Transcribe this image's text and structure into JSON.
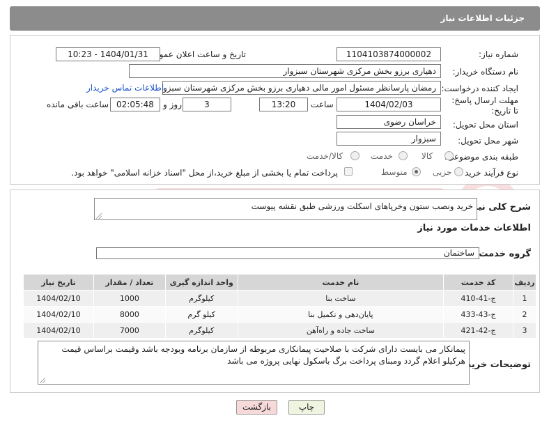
{
  "header": {
    "title": "جزئیات اطلاعات نیاز"
  },
  "fields": {
    "need_number_label": "شماره نیاز:",
    "need_number": "1104103874000002",
    "announce_label": "تاریخ و ساعت اعلان عمومی:",
    "announce_value": "1404/01/31 - 10:23",
    "buyer_org_label": "نام دستگاه خریدار:",
    "buyer_org": "دهیاری برزو بخش مرکزی شهرستان سبزوار",
    "requester_label": "ایجاد کننده درخواست:",
    "requester": "رمضان پارسانظر مسئول امور مالی دهیاری برزو بخش مرکزی شهرستان سبزوار",
    "contact_link": "اطلاعات تماس خریدار",
    "deadline_label": "مهلت ارسال پاسخ: تا تاریخ:",
    "deadline_date": "1404/02/03",
    "time_label": "ساعت",
    "deadline_time": "13:20",
    "days_value": "3",
    "days_label": "روز و",
    "remaining_time": "02:05:48",
    "remaining_label": "ساعت باقی مانده",
    "province_label": "استان محل تحویل:",
    "province": "خراسان رضوی",
    "city_label": "شهر محل تحویل:",
    "city": "سبزوار",
    "category_label": "طبقه بندی موضوعی:",
    "category_options": [
      "کالا",
      "خدمت",
      "کالا/خدمت"
    ],
    "purchase_type_label": "نوع فرآیند خرید :",
    "purchase_options": [
      "جزیی",
      "متوسط"
    ],
    "payment_note": "پرداخت تمام یا بخشی از مبلغ خرید،از محل \"اسناد خزانه اسلامی\" خواهد بود."
  },
  "summary": {
    "label": "شرح کلی نیاز:",
    "text": "خرید ونصب ستون وخرپاهای اسکلت ورزشی طبق نقشه پیوست"
  },
  "services": {
    "section_title": "اطلاعات خدمات مورد نیاز",
    "group_label": "گروه خدمت:",
    "group_value": "ساختمان",
    "columns": [
      "ردیف",
      "کد خدمت",
      "نام خدمت",
      "واحد اندازه گیری",
      "تعداد / مقدار",
      "تاریخ نیاز"
    ],
    "rows": [
      {
        "row": "1",
        "code": "ج-41-410",
        "name": "ساخت بنا",
        "unit": "کیلوگرم",
        "qty": "1000",
        "date": "1404/02/10"
      },
      {
        "row": "2",
        "code": "ج-43-433",
        "name": "پایان‌دهی و تکمیل بنا",
        "unit": "کیلو گرم",
        "qty": "8000",
        "date": "1404/02/10"
      },
      {
        "row": "3",
        "code": "ج-42-421",
        "name": "ساخت جاده و راه‌آهن",
        "unit": "کیلوگرم",
        "qty": "7000",
        "date": "1404/02/10"
      }
    ]
  },
  "buyer_notes": {
    "label": "توضیحات خریدار:",
    "text": "پیمانکار می بایست دارای شرکت با صلاحیت پیمانکاری مربوطه از سازمان برنامه وبودجه باشد وقیمت براساس قیمت هرکیلو اعلام گردد ومبنای پرداخت برگ باسکول نهایی پروژه می باشد"
  },
  "buttons": {
    "print": "چاپ",
    "back": "بازگشت"
  },
  "colors": {
    "header_bg": "#8c8c8c",
    "link": "#1a54c7",
    "back_btn_bg": "#f7d9d9",
    "print_btn_bg": "#eef4df"
  }
}
